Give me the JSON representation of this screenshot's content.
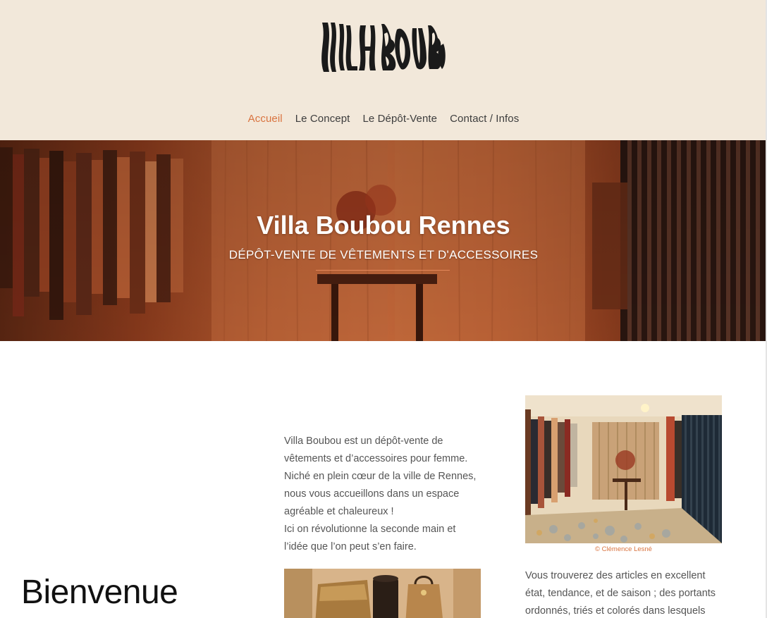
{
  "brand": {
    "logo_text": "VILLA BOUBOU"
  },
  "nav": {
    "items": [
      {
        "label": "Accueil",
        "active": true
      },
      {
        "label": "Le Concept",
        "active": false
      },
      {
        "label": "Le Dépôt-Vente",
        "active": false
      },
      {
        "label": "Contact / Infos",
        "active": false
      }
    ]
  },
  "hero": {
    "title": "Villa Boubou Rennes",
    "subtitle": "DÉPÔT-VENTE DE VÊTEMENTS ET D'ACCESSOIRES"
  },
  "main": {
    "heading": "Bienvenue",
    "intro_lines": [
      "Villa Boubou est un dépôt-vente de",
      "vêtements et d’accessoires pour femme.",
      "Niché en plein cœur de la ville de Rennes,",
      "nous vous accueillons dans un espace",
      "agréable et chaleureux !",
      "Ici on révolutionne la seconde main et",
      "l’idée que l’on peut s’en faire."
    ],
    "photo_credit": "© Clémence Lesné",
    "desc_lines": [
      "Vous trouverez des articles en excellent",
      "état, tendance, et de saison ; des portants",
      "ordonnés, triés et colorés dans lesquels"
    ]
  },
  "colors": {
    "header_bg": "#f2e8da",
    "accent": "#d9733f",
    "text": "#555555"
  }
}
